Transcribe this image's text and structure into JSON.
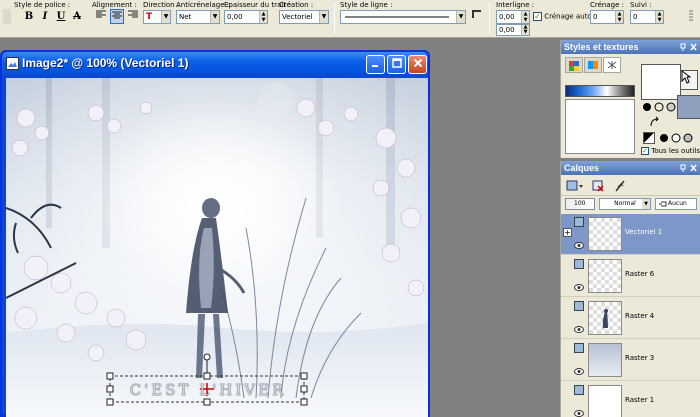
{
  "toolbar": {
    "font_style_label": "Style de police :",
    "bold": "B",
    "italic": "I",
    "underline": "U",
    "strike": "A",
    "alignment_label": "Alignement :",
    "direction_label": "Direction :",
    "antialias_label": "Anticrénelage :",
    "antialias_value": "Net",
    "stroke_width_label": "Epaisseur du trait :",
    "stroke_width_value": "0,00",
    "creation_label": "Création :",
    "creation_value": "Vectoriel",
    "line_style_label": "Style de ligne :",
    "leading_label": "Interligne :",
    "leading_value": "0,00",
    "kerning_value": "0,00",
    "auto_kerning_label": "Crénage auto",
    "crenage_label": "Crénage :",
    "crenage_value": "0",
    "tracking_label": "Suivi :",
    "tracking_value": "0"
  },
  "image_window": {
    "title": "Image2* @  100% (Vectoriel 1)",
    "text_object": "C'EST L'HIVER"
  },
  "styles_panel": {
    "title": "Styles et textures",
    "all_tools_label": "Tous les outils",
    "colors": {
      "accent": "#7d97c9",
      "swatch_gray": "#8ea0be"
    }
  },
  "layers_panel": {
    "title": "Calques",
    "opacity": "100",
    "blend_mode": "Normal",
    "lock_label": "Aucun",
    "layers": [
      {
        "name": "Vectoriel 1",
        "selected": true
      },
      {
        "name": "Raster 6",
        "selected": false
      },
      {
        "name": "Raster 4",
        "selected": false
      },
      {
        "name": "Raster 3",
        "selected": false
      },
      {
        "name": "Raster 1",
        "selected": false
      }
    ]
  }
}
